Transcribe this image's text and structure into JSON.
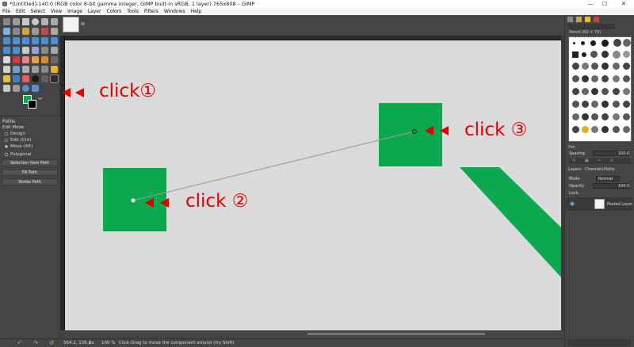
{
  "window": {
    "title": "*[Untitled]-140.0 (RGB color 8-bit gamma integer, GIMP built-in sRGB, 1 layer) 765x808 – GIMP",
    "controls": [
      "—",
      "☐",
      "✕"
    ]
  },
  "menubar": {
    "items": [
      "File",
      "Edit",
      "Select",
      "View",
      "Image",
      "Layer",
      "Colors",
      "Tools",
      "Filters",
      "Windows",
      "Help"
    ]
  },
  "toolbox": {
    "fg_color": "#0aa84f",
    "bg_color": "#000000"
  },
  "tool_options": {
    "title": "Paths",
    "edit_mode_label": "Edit Mode",
    "modes": [
      "Design",
      "Edit (Ctrl)",
      "Move (Alt)"
    ],
    "selected_mode_index": 2,
    "polygonal_label": "Polygonal",
    "buttons": [
      "Selection from Path",
      "Fill Path",
      "Stroke Path"
    ]
  },
  "image_tab": {
    "close_glyph": "⊠"
  },
  "canvas": {
    "background": "#dadada",
    "shape_color": "#0aa84f"
  },
  "statusbar": {
    "coords": "564.2, 136.2",
    "unit": "px",
    "zoom": "100 %",
    "message": "Click-Drag to move the component around (try Shift)"
  },
  "dock": {
    "brush_name": "Pencil (60 × 70)",
    "brush_tag": "Pen",
    "spacing_label": "Spacing",
    "spacing_value": "100.0",
    "tabs": [
      "Layers",
      "Channels",
      "Paths"
    ],
    "mode_label": "Mode",
    "mode_value": "Normal",
    "opacity_label": "Opacity",
    "opacity_value": "100.0",
    "lock_label": "Lock:",
    "layer_name": "Pasted Layer"
  },
  "annotations": {
    "click1": "click①",
    "click2": "click ②",
    "click3": "click ③",
    "color": "#e00000"
  }
}
